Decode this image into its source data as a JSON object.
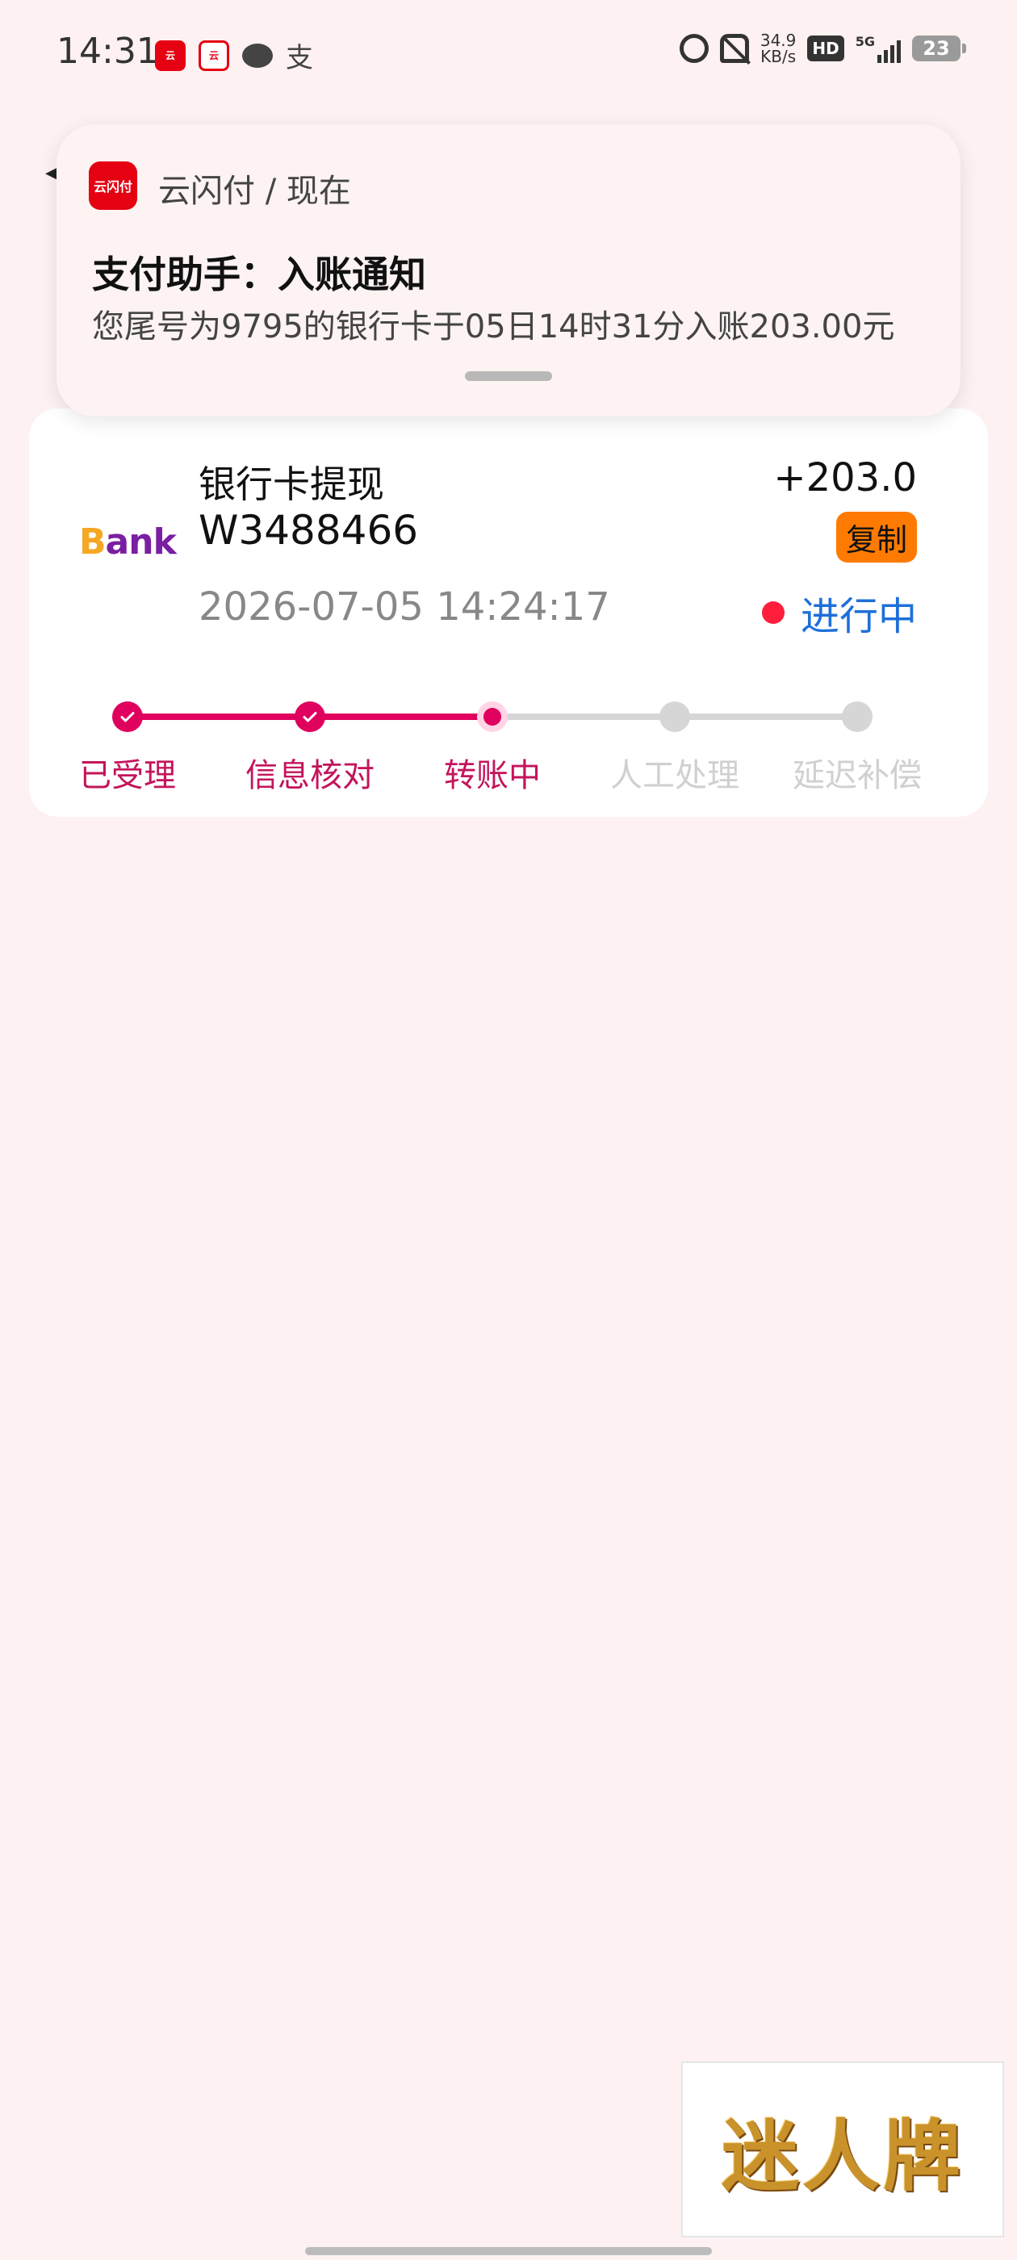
{
  "status_bar": {
    "time": "14:31",
    "alipay_char": "支",
    "net_speed_value": "34.9",
    "net_speed_unit": "KB/s",
    "hd_label": "HD",
    "network_label": "5G",
    "battery_level": "23"
  },
  "notification": {
    "app_icon_text": "云闪付",
    "source": "云闪付 / 现在",
    "title": "支付助手：入账通知",
    "body": "您尾号为9795的银行卡于05日14时31分入账203.00元"
  },
  "transaction": {
    "bank_logo_first": "B",
    "bank_logo_rest": "ank",
    "title": "银行卡提现",
    "order_id": "W3488466",
    "amount": "+203.0",
    "copy_label": "复制",
    "datetime": "2026-07-05 14:24:17",
    "status": "进行中",
    "status_color": "#1e6fd9"
  },
  "progress": {
    "current_step": 3,
    "steps": [
      {
        "label": "已受理",
        "state": "done"
      },
      {
        "label": "信息核对",
        "state": "done"
      },
      {
        "label": "转账中",
        "state": "current"
      },
      {
        "label": "人工处理",
        "state": "pending"
      },
      {
        "label": "延迟补偿",
        "state": "pending"
      }
    ],
    "active_color": "#e0005e",
    "pending_color": "#d6d6d6"
  },
  "watermark": {
    "text": "迷人牌"
  }
}
